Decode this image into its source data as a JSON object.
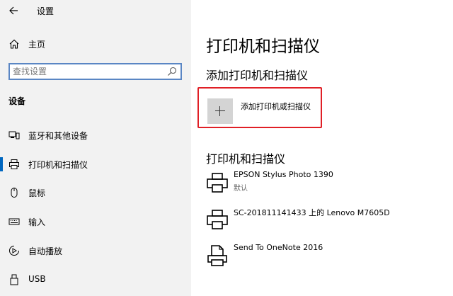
{
  "window": {
    "title": "设置"
  },
  "sidebar": {
    "home_label": "主页",
    "search_placeholder": "查找设置",
    "section_label": "设备",
    "items": [
      {
        "label": "蓝牙和其他设备",
        "icon": "bluetooth-devices-icon"
      },
      {
        "label": "打印机和扫描仪",
        "icon": "printer-icon",
        "active": true
      },
      {
        "label": "鼠标",
        "icon": "mouse-icon"
      },
      {
        "label": "输入",
        "icon": "keyboard-icon"
      },
      {
        "label": "自动播放",
        "icon": "autoplay-icon"
      },
      {
        "label": "USB",
        "icon": "usb-icon"
      }
    ]
  },
  "main": {
    "page_title": "打印机和扫描仪",
    "add_section_title": "添加打印机和扫描仪",
    "add_button_label": "添加打印机或扫描仪",
    "list_section_title": "打印机和扫描仪",
    "printers": [
      {
        "name": "EPSON Stylus Photo 1390",
        "status": "默认",
        "icon": "printer-icon"
      },
      {
        "name": "SC-201811141433 上的 Lenovo M7605D",
        "status": "",
        "icon": "printer-icon"
      },
      {
        "name": "Send To OneNote 2016",
        "status": "",
        "icon": "document-printer-icon"
      }
    ]
  },
  "colors": {
    "sidebar_bg": "#f2f2f2",
    "accent": "#0067c0",
    "highlight_border": "#e01f26",
    "search_border": "#5a86c4"
  }
}
